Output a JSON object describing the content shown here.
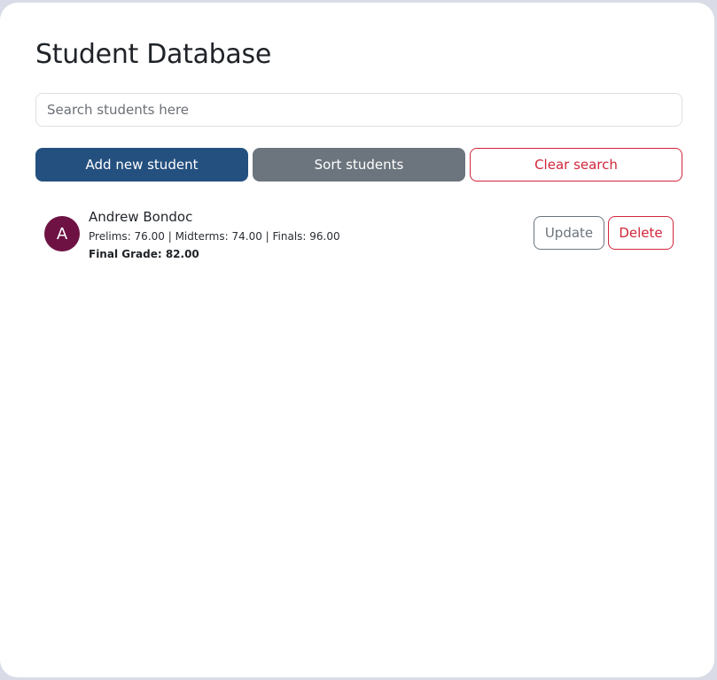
{
  "page": {
    "title": "Student Database"
  },
  "search": {
    "placeholder": "Search students here",
    "value": ""
  },
  "actions": {
    "add_label": "Add new student",
    "sort_label": "Sort students",
    "clear_label": "Clear search"
  },
  "students": [
    {
      "initial": "A",
      "name": "Andrew Bondoc",
      "scores": "Prelims: 76.00 | Midterms: 74.00 | Finals: 96.00",
      "final_grade": "Final Grade: 82.00",
      "update_label": "Update",
      "delete_label": "Delete"
    }
  ],
  "colors": {
    "primary": "#24507f",
    "secondary": "#6c757d",
    "danger": "#d1263a",
    "avatar": "#6e1244"
  }
}
